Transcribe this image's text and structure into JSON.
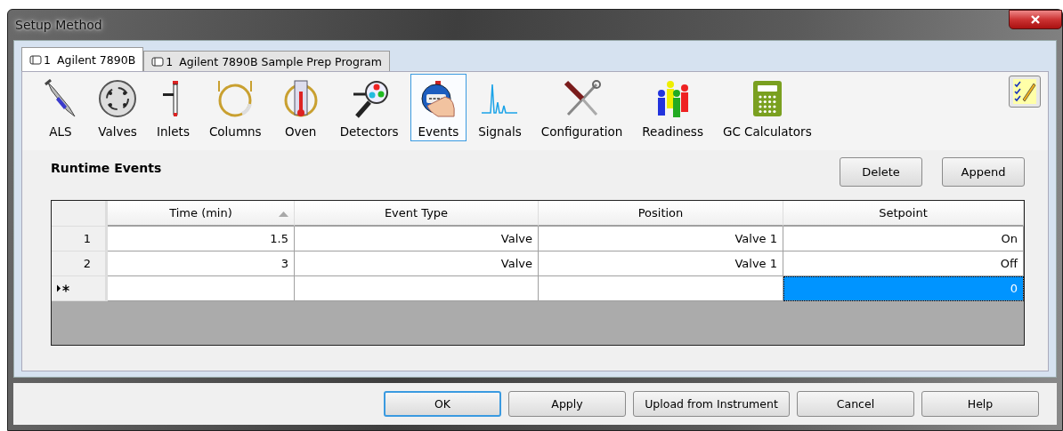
{
  "window": {
    "title": "Setup Method"
  },
  "tabs": [
    {
      "number": "1",
      "label": "Agilent 7890B",
      "selected": true
    },
    {
      "number": "1",
      "label": "Agilent 7890B Sample Prep Program",
      "selected": false
    }
  ],
  "toolbar": [
    {
      "kind": "als",
      "label": "ALS",
      "selected": false
    },
    {
      "kind": "valves",
      "label": "Valves",
      "selected": false
    },
    {
      "kind": "inlets",
      "label": "Inlets",
      "selected": false
    },
    {
      "kind": "columns",
      "label": "Columns",
      "selected": false
    },
    {
      "kind": "oven",
      "label": "Oven",
      "selected": false
    },
    {
      "kind": "detectors",
      "label": "Detectors",
      "selected": false
    },
    {
      "kind": "events",
      "label": "Events",
      "selected": true
    },
    {
      "kind": "signals",
      "label": "Signals",
      "selected": false
    },
    {
      "kind": "configuration",
      "label": "Configuration",
      "selected": false
    },
    {
      "kind": "readiness",
      "label": "Readiness",
      "selected": false
    },
    {
      "kind": "calculators",
      "label": "GC Calculators",
      "selected": false
    }
  ],
  "section": {
    "title": "Runtime Events",
    "buttons": [
      "Delete",
      "Append"
    ]
  },
  "table": {
    "columns": [
      {
        "label": "Time (min)",
        "sorted": true
      },
      {
        "label": "Event Type",
        "sorted": false
      },
      {
        "label": "Position",
        "sorted": false
      },
      {
        "label": "Setpoint",
        "sorted": false
      }
    ],
    "rows": [
      {
        "kind": "data",
        "header": "1",
        "cells": [
          {
            "text": "1.5",
            "selected": false
          },
          {
            "text": "Valve",
            "selected": false
          },
          {
            "text": "Valve 1",
            "selected": false
          },
          {
            "text": "On",
            "selected": false
          }
        ]
      },
      {
        "kind": "data",
        "header": "2",
        "cells": [
          {
            "text": "3",
            "selected": false
          },
          {
            "text": "Valve",
            "selected": false
          },
          {
            "text": "Valve 1",
            "selected": false
          },
          {
            "text": "Off",
            "selected": false
          }
        ]
      },
      {
        "kind": "new",
        "cells": [
          {
            "selected": false
          },
          {
            "selected": false
          },
          {
            "selected": false
          },
          {
            "text": "0",
            "selected": true
          }
        ]
      }
    ]
  },
  "footer": [
    {
      "label": "OK",
      "default": true
    },
    {
      "label": "Apply",
      "default": false
    },
    {
      "label": "Upload from Instrument",
      "default": false
    },
    {
      "label": "Cancel",
      "default": false
    },
    {
      "label": "Help",
      "default": false
    }
  ]
}
